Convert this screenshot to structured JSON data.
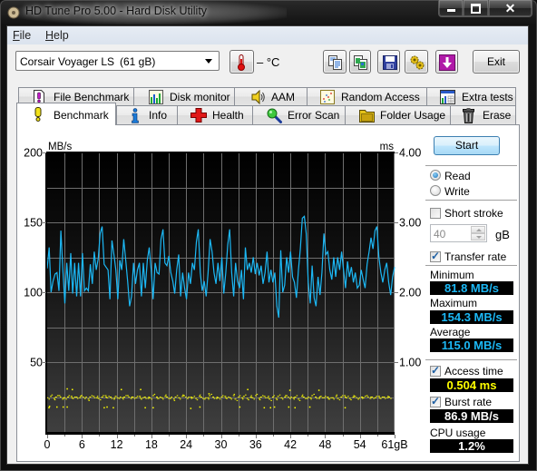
{
  "window": {
    "title": "HD Tune Pro 5.00 - Hard Disk Utility",
    "close_glyph": "✕"
  },
  "menu": [
    {
      "accel": "F",
      "rest": "ile"
    },
    {
      "accel": "H",
      "rest": "elp"
    }
  ],
  "toolbar": {
    "drive_name": "Corsair Voyager LS",
    "drive_size": "(61 gB)",
    "temperature": "– °C",
    "icon_buttons": [
      "copy-text-icon",
      "copy-screenshot-icon",
      "save-icon",
      "options-icon",
      "download-icon"
    ],
    "exit_label": "Exit"
  },
  "tabs": {
    "row1": [
      {
        "label": "File Benchmark",
        "icon": "file-benchmark-icon"
      },
      {
        "label": "Disk monitor",
        "icon": "disk-monitor-icon"
      },
      {
        "label": "AAM",
        "icon": "speaker-icon"
      },
      {
        "label": "Random Access",
        "icon": "random-access-icon"
      },
      {
        "label": "Extra tests",
        "icon": "extra-tests-icon"
      }
    ],
    "row2": [
      {
        "label": "Benchmark",
        "icon": "exclamation-icon",
        "selected": true
      },
      {
        "label": "Info",
        "icon": "info-icon"
      },
      {
        "label": "Health",
        "icon": "red-cross-icon"
      },
      {
        "label": "Error Scan",
        "icon": "magnifier-icon"
      },
      {
        "label": "Folder Usage",
        "icon": "folder-icon"
      },
      {
        "label": "Erase",
        "icon": "trash-icon"
      }
    ]
  },
  "benchmark": {
    "start_label": "Start",
    "mode": {
      "read_label": "Read",
      "write_label": "Write",
      "selected": "read"
    },
    "short_stroke": {
      "label": "Short stroke",
      "checked": false,
      "value": "40",
      "unit": "gB"
    },
    "transfer_rate": {
      "label": "Transfer rate",
      "checked": true
    },
    "minimum": {
      "label": "Minimum",
      "value": "81.8 MB/s"
    },
    "maximum": {
      "label": "Maximum",
      "value": "154.3 MB/s"
    },
    "average": {
      "label": "Average",
      "value": "115.0 MB/s"
    },
    "access_time": {
      "label": "Access time",
      "checked": true,
      "value": "0.504 ms"
    },
    "burst_rate": {
      "label": "Burst rate",
      "checked": true,
      "value": "86.9 MB/s"
    },
    "cpu_usage": {
      "label": "CPU usage",
      "value": "1.2%"
    },
    "colors": {
      "transfer": "#1cb8f5",
      "access": "#ffff00"
    }
  },
  "chart_data": {
    "type": "line",
    "title": "",
    "xlabel": "gB",
    "y_left_label": "MB/s",
    "y_right_label": "ms",
    "x_range": [
      0,
      61
    ],
    "y_left_range": [
      0,
      200
    ],
    "y_right_range": [
      0,
      4
    ],
    "y_left_ticks": [
      {
        "value": 50,
        "label": "50"
      },
      {
        "value": 100,
        "label": "100"
      },
      {
        "value": 150,
        "label": "150"
      },
      {
        "value": 200,
        "label": "200"
      }
    ],
    "y_right_ticks": [
      {
        "value": 1,
        "label": "1.00"
      },
      {
        "value": 2,
        "label": "2.00"
      },
      {
        "value": 3,
        "label": "3.00"
      },
      {
        "value": 4,
        "label": "4.00"
      }
    ],
    "x_ticks": [
      "0",
      "6",
      "12",
      "18",
      "24",
      "30",
      "36",
      "42",
      "48",
      "54",
      "61gB"
    ],
    "grid": true,
    "grid_divisions": {
      "x": 20,
      "y": 8
    },
    "series": [
      {
        "name": "Transfer rate",
        "unit": "MB/s",
        "axis": "left",
        "type": "line",
        "color": "#1cb8f5",
        "x_start": 0,
        "x_end": 61,
        "values": [
          117,
          132,
          100,
          108,
          113,
          114,
          101,
          144,
          116,
          92,
          121,
          101,
          128,
          99,
          121,
          97,
          121,
          97,
          128,
          101,
          103,
          101,
          120,
          106,
          129,
          116,
          124,
          142,
          147,
          120,
          118,
          116,
          95,
          137,
          127,
          116,
          95,
          123,
          116,
          138,
          123,
          108,
          90,
          97,
          121,
          106,
          116,
          121,
          97,
          121,
          103,
          123,
          132,
          116,
          95,
          121,
          114,
          113,
          138,
          145,
          121,
          119,
          126,
          114,
          108,
          99,
          116,
          127,
          97,
          114,
          103,
          95,
          114,
          106,
          121,
          116,
          136,
          145,
          114,
          101,
          108,
          97,
          114,
          138,
          129,
          114,
          106,
          121,
          108,
          125,
          99,
          114,
          134,
          145,
          114,
          97,
          121,
          108,
          103,
          116,
          95,
          132,
          116,
          121,
          114,
          125,
          113,
          121,
          112,
          119,
          106,
          114,
          129,
          107,
          116,
          107,
          114,
          90,
          81.8,
          130,
          100,
          105,
          125,
          114,
          129,
          111,
          107,
          96,
          116,
          131,
          153,
          154.3,
          142,
          107,
          92,
          119,
          96,
          90,
          111,
          98,
          114,
          142,
          127,
          129,
          116,
          109,
          125,
          111,
          125,
          116,
          129,
          116,
          103,
          122,
          111,
          118,
          107,
          114,
          103,
          105,
          116,
          109,
          103,
          120,
          129,
          139,
          131,
          144,
          147,
          125,
          114,
          107,
          116,
          121,
          107,
          98,
          111,
          118
        ]
      },
      {
        "name": "Access time",
        "unit": "ms",
        "axis": "right",
        "type": "scatter",
        "color": "#ffff00",
        "x_start": 0,
        "x_end": 60,
        "values": [
          0.49,
          0.51,
          0.48,
          0.5,
          0.52,
          0.47,
          0.49,
          0.5,
          0.51,
          0.48,
          0.5,
          0.49,
          0.52,
          0.48,
          0.47,
          0.5,
          0.51,
          0.49,
          0.48,
          0.5,
          0.52,
          0.49,
          0.5,
          0.47,
          0.51,
          0.48,
          0.49,
          0.5,
          0.52,
          0.48,
          0.5,
          0.49,
          0.51,
          0.47,
          0.5,
          0.48,
          0.49,
          0.52,
          0.5,
          0.48,
          0.49,
          0.51,
          0.5,
          0.48,
          0.47,
          0.5,
          0.49,
          0.51,
          0.52,
          0.48,
          0.5,
          0.49,
          0.48,
          0.51,
          0.5,
          0.47,
          0.49,
          0.52,
          0.5,
          0.48,
          0.49,
          0.5,
          0.51,
          0.48,
          0.49,
          0.52,
          0.47,
          0.5,
          0.49,
          0.51,
          0.48,
          0.5,
          0.49,
          0.52,
          0.48,
          0.5,
          0.51,
          0.49,
          0.47,
          0.5,
          0.48,
          0.51,
          0.49,
          0.5,
          0.52,
          0.48,
          0.49,
          0.5,
          0.47,
          0.51,
          0.5,
          0.48,
          0.49,
          0.52,
          0.5,
          0.48,
          0.51,
          0.49,
          0.5,
          0.47,
          0.49,
          0.51,
          0.48,
          0.5,
          0.52,
          0.49,
          0.48,
          0.5,
          0.51,
          0.47,
          0.5,
          0.49,
          0.52,
          0.48,
          0.5,
          0.49,
          0.51,
          0.48,
          0.5,
          0.49,
          0.5
        ],
        "outliers": [
          [
            3.4,
            0.62
          ],
          [
            4.3,
            0.61
          ],
          [
            12.9,
            0.61
          ],
          [
            16.3,
            0.61
          ],
          [
            28.3,
            0.55
          ],
          [
            35.1,
            0.61
          ],
          [
            42.5,
            0.6
          ],
          [
            47.6,
            0.6
          ],
          [
            0.2,
            0.35
          ],
          [
            0.3,
            0.37
          ],
          [
            1.6,
            0.36
          ],
          [
            2.7,
            0.36
          ],
          [
            3.4,
            0.36
          ],
          [
            9.9,
            0.35
          ],
          [
            10.4,
            0.36
          ],
          [
            11.5,
            0.35
          ],
          [
            17.1,
            0.35
          ],
          [
            18.5,
            0.35
          ],
          [
            25.1,
            0.34
          ],
          [
            26.7,
            0.36
          ],
          [
            33.7,
            0.36
          ],
          [
            38.0,
            0.35
          ],
          [
            39.1,
            0.35
          ],
          [
            39.8,
            0.36
          ],
          [
            42.3,
            0.36
          ],
          [
            43.4,
            0.35
          ],
          [
            46.0,
            0.36
          ],
          [
            52.2,
            0.35
          ]
        ]
      }
    ]
  }
}
